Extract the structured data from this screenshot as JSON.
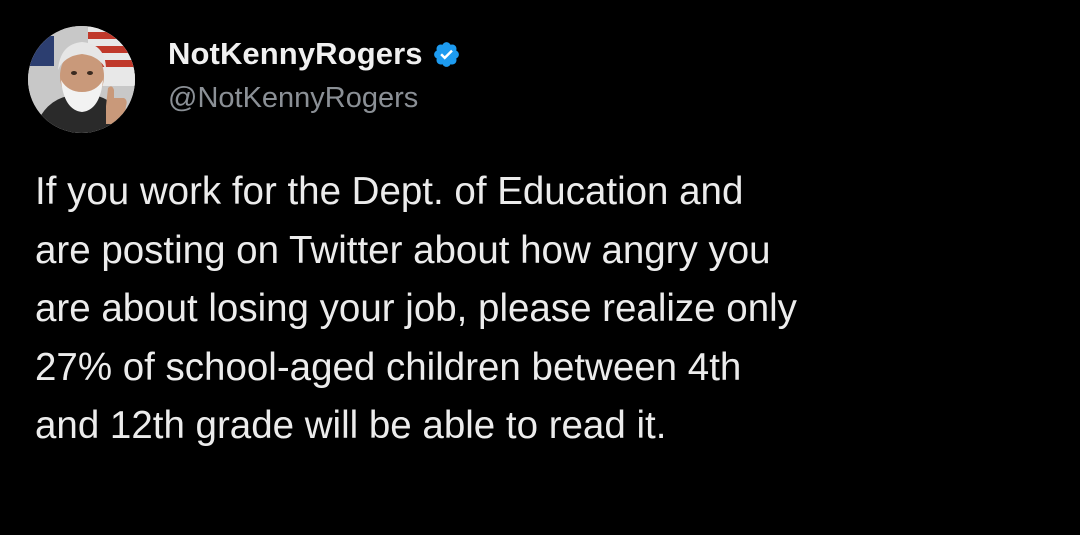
{
  "tweet": {
    "author": {
      "display_name": "NotKennyRogers",
      "handle": "@NotKennyRogers",
      "verified": true
    },
    "text": "If you work for the Dept. of Education and\nare posting on Twitter about how angry you\nare about losing your job, please realize only\n27% of school-aged children between 4th\nand 12th grade will be able to read it."
  },
  "colors": {
    "background": "#000000",
    "text": "#e7e9ea",
    "handle": "#8b9096",
    "verified_badge": "#1d9bf0"
  },
  "icons": {
    "avatar": "avatar-photo",
    "verified": "verified-badge-icon"
  }
}
